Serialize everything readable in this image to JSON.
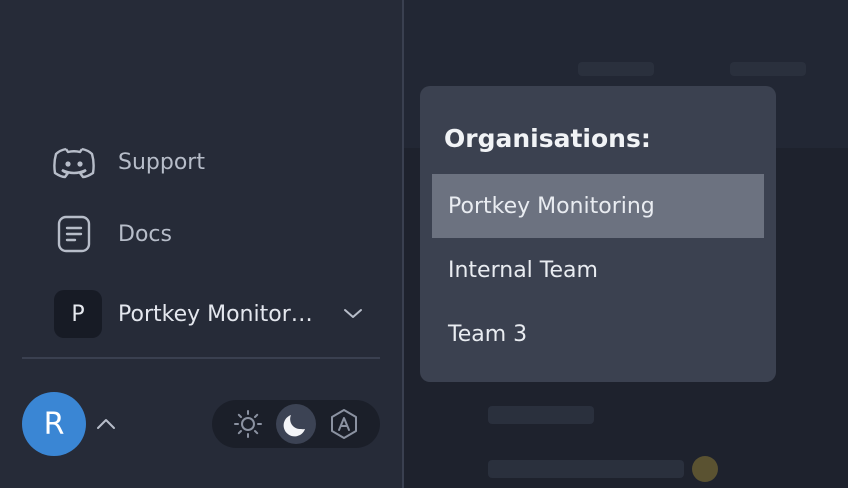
{
  "sidebar": {
    "items": [
      {
        "label": "Support",
        "icon": "discord-icon"
      },
      {
        "label": "Docs",
        "icon": "document-icon"
      }
    ],
    "org_switcher": {
      "avatar_letter": "P",
      "name": "Portkey Monitoring"
    },
    "user": {
      "avatar_letter": "R",
      "avatar_color": "#3a86d4"
    },
    "theme": {
      "options": [
        "light",
        "dark",
        "auto"
      ],
      "selected": "dark"
    }
  },
  "dropdown": {
    "title": "Organisations:",
    "items": [
      "Portkey Monitoring",
      "Internal Team",
      "Team 3"
    ],
    "selected_index": 0
  }
}
